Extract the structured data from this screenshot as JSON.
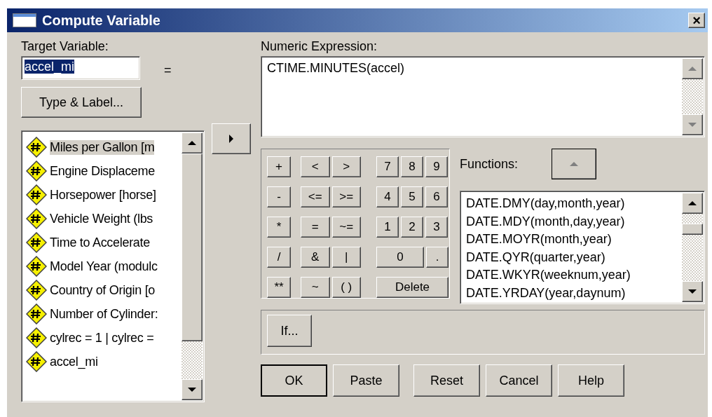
{
  "window": {
    "title": "Compute Variable",
    "close": "×"
  },
  "target": {
    "label": "Target Variable:",
    "value": "accel_mi",
    "text_selected": true,
    "equals": "="
  },
  "type_label_button": {
    "label": "Type & Label..."
  },
  "variables": [
    {
      "name": "Miles per Gallon [m",
      "selected": true
    },
    {
      "name": "Engine Displaceme",
      "selected": false
    },
    {
      "name": "Horsepower [horse]",
      "selected": false
    },
    {
      "name": "Vehicle Weight (lbs",
      "selected": false
    },
    {
      "name": "Time to Accelerate",
      "selected": false
    },
    {
      "name": "Model Year (modulc",
      "selected": false
    },
    {
      "name": "Country of Origin [o",
      "selected": false
    },
    {
      "name": "Number of Cylinder:",
      "selected": false
    },
    {
      "name": "cylrec = 1 | cylrec =",
      "selected": false
    },
    {
      "name": "accel_mi",
      "selected": false
    }
  ],
  "expression": {
    "label": "Numeric Expression:",
    "value": "CTIME.MINUTES(accel)"
  },
  "keypad": [
    {
      "operators": [
        "+"
      ],
      "relations": [
        "<",
        ">"
      ],
      "digits": [
        "7",
        "8",
        "9"
      ]
    },
    {
      "operators": [
        "-"
      ],
      "relations": [
        "<=",
        ">="
      ],
      "digits": [
        "4",
        "5",
        "6"
      ]
    },
    {
      "operators": [
        "*"
      ],
      "relations": [
        "=",
        "~="
      ],
      "digits": [
        "1",
        "2",
        "3"
      ]
    },
    {
      "operators": [
        "/"
      ],
      "relations": [
        "&",
        "|"
      ],
      "digits": [
        "0",
        "."
      ]
    },
    {
      "operators": [
        "**"
      ],
      "relations": [
        "~",
        "( )"
      ],
      "digits": [
        "Delete"
      ]
    }
  ],
  "functions": {
    "label": "Functions:",
    "items": [
      {
        "name": "DATE.DMY(day,month,year)",
        "selected": false
      },
      {
        "name": "DATE.MDY(month,day,year)",
        "selected": false
      },
      {
        "name": "DATE.MOYR(month,year)",
        "selected": false
      },
      {
        "name": "DATE.QYR(quarter,year)",
        "selected": false
      },
      {
        "name": "DATE.WKYR(weeknum,year)",
        "selected": false
      },
      {
        "name": "DATE.YRDAY(year,daynum)",
        "selected": false
      }
    ]
  },
  "if_button": {
    "label": "If..."
  },
  "buttons": [
    {
      "label": "OK",
      "default": true
    },
    {
      "label": "Paste",
      "default": false
    },
    {
      "label": "Reset",
      "default": false
    },
    {
      "label": "Cancel",
      "default": false
    },
    {
      "label": "Help",
      "default": false
    }
  ]
}
